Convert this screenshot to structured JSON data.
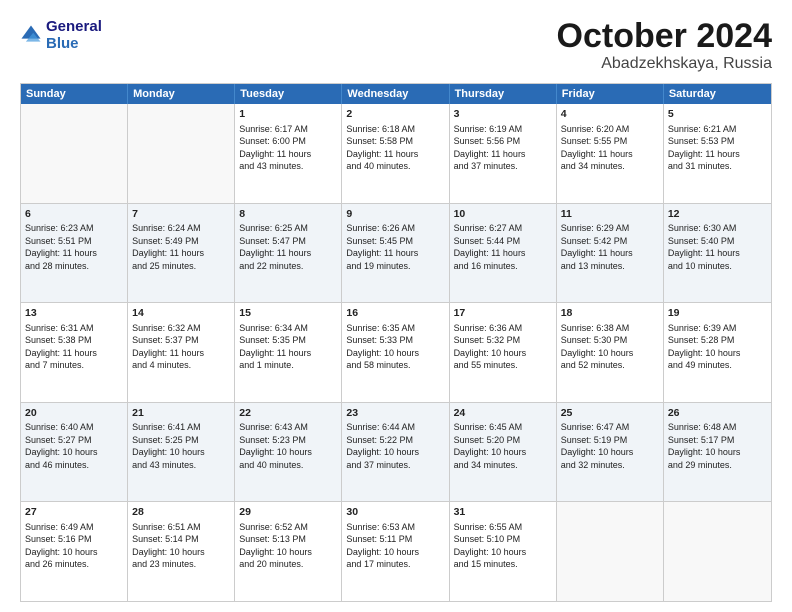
{
  "header": {
    "logo_line1": "General",
    "logo_line2": "Blue",
    "main_title": "October 2024",
    "subtitle": "Abadzekhskaya, Russia"
  },
  "calendar": {
    "days_of_week": [
      "Sunday",
      "Monday",
      "Tuesday",
      "Wednesday",
      "Thursday",
      "Friday",
      "Saturday"
    ],
    "rows": [
      [
        {
          "day": "",
          "info": ""
        },
        {
          "day": "",
          "info": ""
        },
        {
          "day": "1",
          "info": "Sunrise: 6:17 AM\nSunset: 6:00 PM\nDaylight: 11 hours\nand 43 minutes."
        },
        {
          "day": "2",
          "info": "Sunrise: 6:18 AM\nSunset: 5:58 PM\nDaylight: 11 hours\nand 40 minutes."
        },
        {
          "day": "3",
          "info": "Sunrise: 6:19 AM\nSunset: 5:56 PM\nDaylight: 11 hours\nand 37 minutes."
        },
        {
          "day": "4",
          "info": "Sunrise: 6:20 AM\nSunset: 5:55 PM\nDaylight: 11 hours\nand 34 minutes."
        },
        {
          "day": "5",
          "info": "Sunrise: 6:21 AM\nSunset: 5:53 PM\nDaylight: 11 hours\nand 31 minutes."
        }
      ],
      [
        {
          "day": "6",
          "info": "Sunrise: 6:23 AM\nSunset: 5:51 PM\nDaylight: 11 hours\nand 28 minutes."
        },
        {
          "day": "7",
          "info": "Sunrise: 6:24 AM\nSunset: 5:49 PM\nDaylight: 11 hours\nand 25 minutes."
        },
        {
          "day": "8",
          "info": "Sunrise: 6:25 AM\nSunset: 5:47 PM\nDaylight: 11 hours\nand 22 minutes."
        },
        {
          "day": "9",
          "info": "Sunrise: 6:26 AM\nSunset: 5:45 PM\nDaylight: 11 hours\nand 19 minutes."
        },
        {
          "day": "10",
          "info": "Sunrise: 6:27 AM\nSunset: 5:44 PM\nDaylight: 11 hours\nand 16 minutes."
        },
        {
          "day": "11",
          "info": "Sunrise: 6:29 AM\nSunset: 5:42 PM\nDaylight: 11 hours\nand 13 minutes."
        },
        {
          "day": "12",
          "info": "Sunrise: 6:30 AM\nSunset: 5:40 PM\nDaylight: 11 hours\nand 10 minutes."
        }
      ],
      [
        {
          "day": "13",
          "info": "Sunrise: 6:31 AM\nSunset: 5:38 PM\nDaylight: 11 hours\nand 7 minutes."
        },
        {
          "day": "14",
          "info": "Sunrise: 6:32 AM\nSunset: 5:37 PM\nDaylight: 11 hours\nand 4 minutes."
        },
        {
          "day": "15",
          "info": "Sunrise: 6:34 AM\nSunset: 5:35 PM\nDaylight: 11 hours\nand 1 minute."
        },
        {
          "day": "16",
          "info": "Sunrise: 6:35 AM\nSunset: 5:33 PM\nDaylight: 10 hours\nand 58 minutes."
        },
        {
          "day": "17",
          "info": "Sunrise: 6:36 AM\nSunset: 5:32 PM\nDaylight: 10 hours\nand 55 minutes."
        },
        {
          "day": "18",
          "info": "Sunrise: 6:38 AM\nSunset: 5:30 PM\nDaylight: 10 hours\nand 52 minutes."
        },
        {
          "day": "19",
          "info": "Sunrise: 6:39 AM\nSunset: 5:28 PM\nDaylight: 10 hours\nand 49 minutes."
        }
      ],
      [
        {
          "day": "20",
          "info": "Sunrise: 6:40 AM\nSunset: 5:27 PM\nDaylight: 10 hours\nand 46 minutes."
        },
        {
          "day": "21",
          "info": "Sunrise: 6:41 AM\nSunset: 5:25 PM\nDaylight: 10 hours\nand 43 minutes."
        },
        {
          "day": "22",
          "info": "Sunrise: 6:43 AM\nSunset: 5:23 PM\nDaylight: 10 hours\nand 40 minutes."
        },
        {
          "day": "23",
          "info": "Sunrise: 6:44 AM\nSunset: 5:22 PM\nDaylight: 10 hours\nand 37 minutes."
        },
        {
          "day": "24",
          "info": "Sunrise: 6:45 AM\nSunset: 5:20 PM\nDaylight: 10 hours\nand 34 minutes."
        },
        {
          "day": "25",
          "info": "Sunrise: 6:47 AM\nSunset: 5:19 PM\nDaylight: 10 hours\nand 32 minutes."
        },
        {
          "day": "26",
          "info": "Sunrise: 6:48 AM\nSunset: 5:17 PM\nDaylight: 10 hours\nand 29 minutes."
        }
      ],
      [
        {
          "day": "27",
          "info": "Sunrise: 6:49 AM\nSunset: 5:16 PM\nDaylight: 10 hours\nand 26 minutes."
        },
        {
          "day": "28",
          "info": "Sunrise: 6:51 AM\nSunset: 5:14 PM\nDaylight: 10 hours\nand 23 minutes."
        },
        {
          "day": "29",
          "info": "Sunrise: 6:52 AM\nSunset: 5:13 PM\nDaylight: 10 hours\nand 20 minutes."
        },
        {
          "day": "30",
          "info": "Sunrise: 6:53 AM\nSunset: 5:11 PM\nDaylight: 10 hours\nand 17 minutes."
        },
        {
          "day": "31",
          "info": "Sunrise: 6:55 AM\nSunset: 5:10 PM\nDaylight: 10 hours\nand 15 minutes."
        },
        {
          "day": "",
          "info": ""
        },
        {
          "day": "",
          "info": ""
        }
      ]
    ]
  }
}
